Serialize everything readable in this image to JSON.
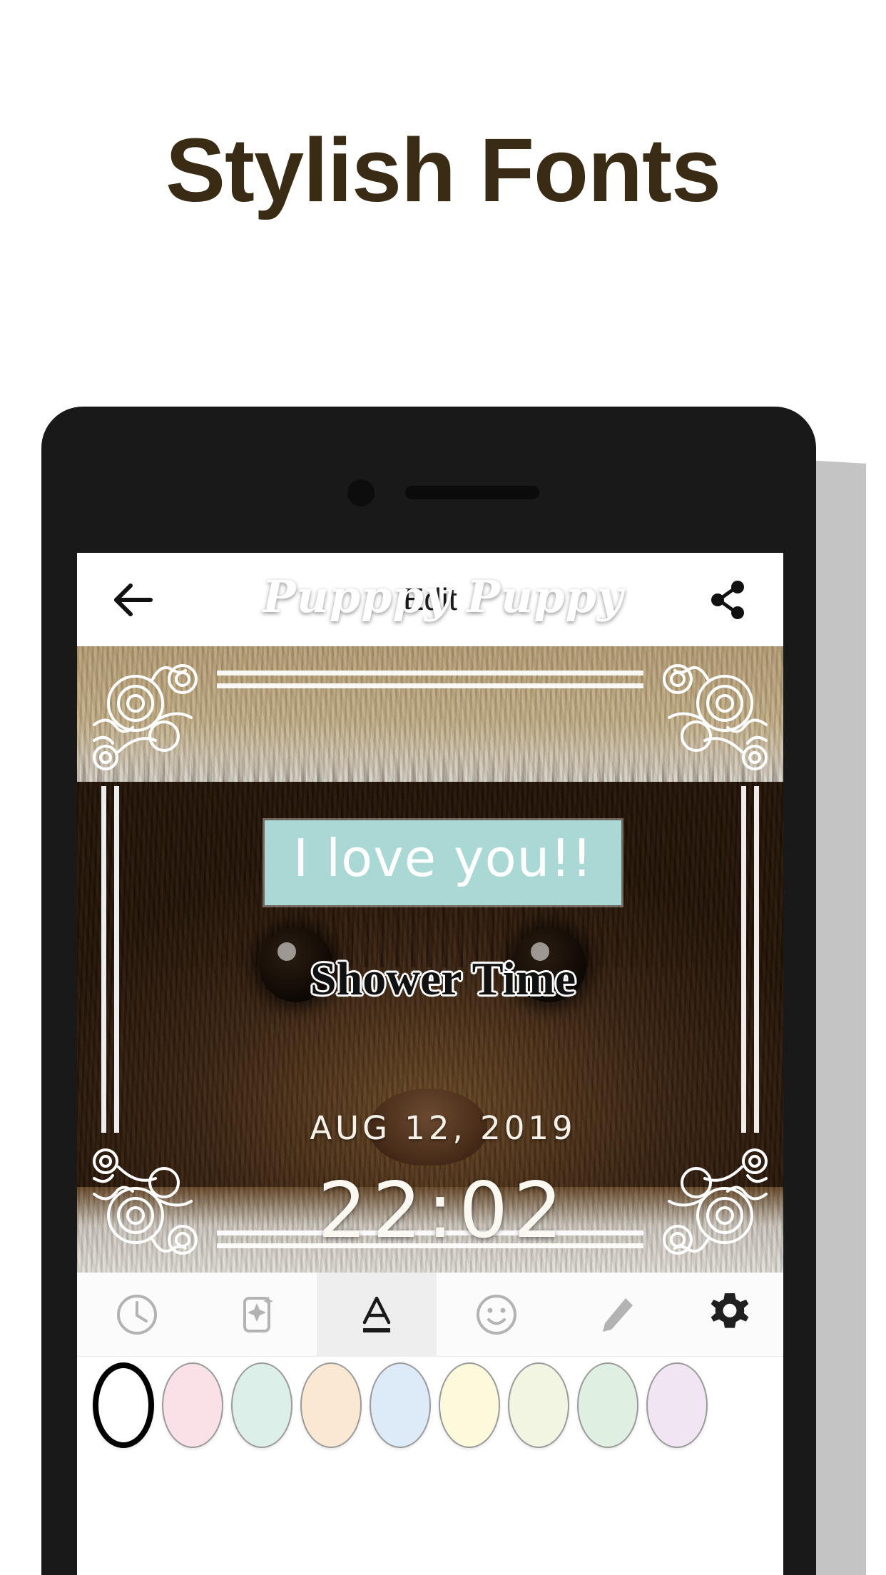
{
  "page": {
    "headline": "Stylish Fonts",
    "headline_color": "#3A2C14",
    "background_color": "#FFFFFF"
  },
  "device": {
    "frame_color": "#191919",
    "shadow_color": "#C4C4C4",
    "camera_icon": "front-camera-dot",
    "speaker_icon": "earpiece-speaker"
  },
  "app": {
    "header": {
      "back_icon": "back-arrow-icon",
      "title": "Edit",
      "share_icon": "share-icon"
    },
    "photo_overlays": {
      "frame_style": "ornate-art-nouveau-corner-frame",
      "script_text": "Pupppy Puppy",
      "highlight_text": "I love you!!",
      "highlight_bg_color": "#A9D8D5",
      "highlight_text_color": "#FFFFFF",
      "serif_text": "Shower Time",
      "date_text": "AUG 12, 2019",
      "time_text": "22:02"
    },
    "toolbar": {
      "items": [
        {
          "name": "clock",
          "icon": "clock-icon",
          "label": "Date & Time",
          "active": false
        },
        {
          "name": "filter",
          "icon": "magic-filter-icon",
          "label": "Filters",
          "active": false
        },
        {
          "name": "text",
          "icon": "text-a-icon",
          "label": "Text",
          "active": true
        },
        {
          "name": "sticker",
          "icon": "smiley-face-icon",
          "label": "Stickers",
          "active": false
        },
        {
          "name": "draw",
          "icon": "pencil-icon",
          "label": "Draw",
          "active": false
        },
        {
          "name": "settings",
          "icon": "gear-icon",
          "label": "Settings",
          "active": false
        }
      ]
    },
    "color_palette": {
      "selected_index": 0,
      "swatches": [
        {
          "name": "white",
          "hex": "#FFFFFF",
          "selected": true
        },
        {
          "name": "pink",
          "hex": "#FAE0E7",
          "selected": false
        },
        {
          "name": "mint",
          "hex": "#DDEFE9",
          "selected": false
        },
        {
          "name": "peach",
          "hex": "#FBE8D2",
          "selected": false
        },
        {
          "name": "light-blue",
          "hex": "#DDEAF7",
          "selected": false
        },
        {
          "name": "light-yellow",
          "hex": "#FCFADB",
          "selected": false
        },
        {
          "name": "pale-lime",
          "hex": "#F2F5E2",
          "selected": false
        },
        {
          "name": "pale-green",
          "hex": "#DFF0E2",
          "selected": false
        },
        {
          "name": "lavender",
          "hex": "#F1E4F3",
          "selected": false
        }
      ]
    }
  }
}
